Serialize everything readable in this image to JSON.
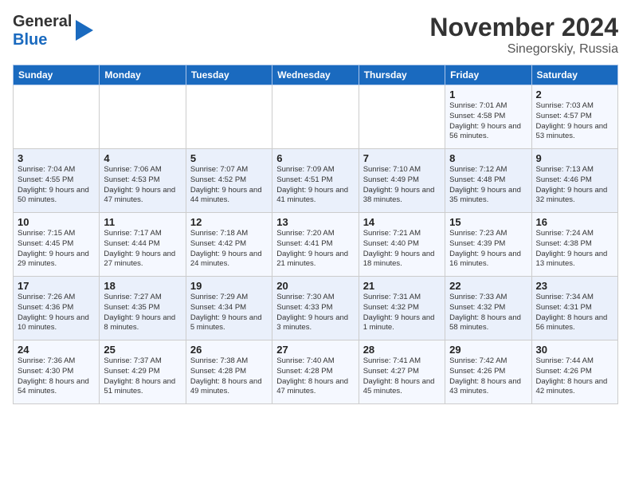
{
  "logo": {
    "line1": "General",
    "line2": "Blue"
  },
  "title": "November 2024",
  "subtitle": "Sinegorskiy, Russia",
  "weekdays": [
    "Sunday",
    "Monday",
    "Tuesday",
    "Wednesday",
    "Thursday",
    "Friday",
    "Saturday"
  ],
  "weeks": [
    [
      {
        "day": "",
        "info": ""
      },
      {
        "day": "",
        "info": ""
      },
      {
        "day": "",
        "info": ""
      },
      {
        "day": "",
        "info": ""
      },
      {
        "day": "",
        "info": ""
      },
      {
        "day": "1",
        "info": "Sunrise: 7:01 AM\nSunset: 4:58 PM\nDaylight: 9 hours and 56 minutes."
      },
      {
        "day": "2",
        "info": "Sunrise: 7:03 AM\nSunset: 4:57 PM\nDaylight: 9 hours and 53 minutes."
      }
    ],
    [
      {
        "day": "3",
        "info": "Sunrise: 7:04 AM\nSunset: 4:55 PM\nDaylight: 9 hours and 50 minutes."
      },
      {
        "day": "4",
        "info": "Sunrise: 7:06 AM\nSunset: 4:53 PM\nDaylight: 9 hours and 47 minutes."
      },
      {
        "day": "5",
        "info": "Sunrise: 7:07 AM\nSunset: 4:52 PM\nDaylight: 9 hours and 44 minutes."
      },
      {
        "day": "6",
        "info": "Sunrise: 7:09 AM\nSunset: 4:51 PM\nDaylight: 9 hours and 41 minutes."
      },
      {
        "day": "7",
        "info": "Sunrise: 7:10 AM\nSunset: 4:49 PM\nDaylight: 9 hours and 38 minutes."
      },
      {
        "day": "8",
        "info": "Sunrise: 7:12 AM\nSunset: 4:48 PM\nDaylight: 9 hours and 35 minutes."
      },
      {
        "day": "9",
        "info": "Sunrise: 7:13 AM\nSunset: 4:46 PM\nDaylight: 9 hours and 32 minutes."
      }
    ],
    [
      {
        "day": "10",
        "info": "Sunrise: 7:15 AM\nSunset: 4:45 PM\nDaylight: 9 hours and 29 minutes."
      },
      {
        "day": "11",
        "info": "Sunrise: 7:17 AM\nSunset: 4:44 PM\nDaylight: 9 hours and 27 minutes."
      },
      {
        "day": "12",
        "info": "Sunrise: 7:18 AM\nSunset: 4:42 PM\nDaylight: 9 hours and 24 minutes."
      },
      {
        "day": "13",
        "info": "Sunrise: 7:20 AM\nSunset: 4:41 PM\nDaylight: 9 hours and 21 minutes."
      },
      {
        "day": "14",
        "info": "Sunrise: 7:21 AM\nSunset: 4:40 PM\nDaylight: 9 hours and 18 minutes."
      },
      {
        "day": "15",
        "info": "Sunrise: 7:23 AM\nSunset: 4:39 PM\nDaylight: 9 hours and 16 minutes."
      },
      {
        "day": "16",
        "info": "Sunrise: 7:24 AM\nSunset: 4:38 PM\nDaylight: 9 hours and 13 minutes."
      }
    ],
    [
      {
        "day": "17",
        "info": "Sunrise: 7:26 AM\nSunset: 4:36 PM\nDaylight: 9 hours and 10 minutes."
      },
      {
        "day": "18",
        "info": "Sunrise: 7:27 AM\nSunset: 4:35 PM\nDaylight: 9 hours and 8 minutes."
      },
      {
        "day": "19",
        "info": "Sunrise: 7:29 AM\nSunset: 4:34 PM\nDaylight: 9 hours and 5 minutes."
      },
      {
        "day": "20",
        "info": "Sunrise: 7:30 AM\nSunset: 4:33 PM\nDaylight: 9 hours and 3 minutes."
      },
      {
        "day": "21",
        "info": "Sunrise: 7:31 AM\nSunset: 4:32 PM\nDaylight: 9 hours and 1 minute."
      },
      {
        "day": "22",
        "info": "Sunrise: 7:33 AM\nSunset: 4:32 PM\nDaylight: 8 hours and 58 minutes."
      },
      {
        "day": "23",
        "info": "Sunrise: 7:34 AM\nSunset: 4:31 PM\nDaylight: 8 hours and 56 minutes."
      }
    ],
    [
      {
        "day": "24",
        "info": "Sunrise: 7:36 AM\nSunset: 4:30 PM\nDaylight: 8 hours and 54 minutes."
      },
      {
        "day": "25",
        "info": "Sunrise: 7:37 AM\nSunset: 4:29 PM\nDaylight: 8 hours and 51 minutes."
      },
      {
        "day": "26",
        "info": "Sunrise: 7:38 AM\nSunset: 4:28 PM\nDaylight: 8 hours and 49 minutes."
      },
      {
        "day": "27",
        "info": "Sunrise: 7:40 AM\nSunset: 4:28 PM\nDaylight: 8 hours and 47 minutes."
      },
      {
        "day": "28",
        "info": "Sunrise: 7:41 AM\nSunset: 4:27 PM\nDaylight: 8 hours and 45 minutes."
      },
      {
        "day": "29",
        "info": "Sunrise: 7:42 AM\nSunset: 4:26 PM\nDaylight: 8 hours and 43 minutes."
      },
      {
        "day": "30",
        "info": "Sunrise: 7:44 AM\nSunset: 4:26 PM\nDaylight: 8 hours and 42 minutes."
      }
    ]
  ]
}
